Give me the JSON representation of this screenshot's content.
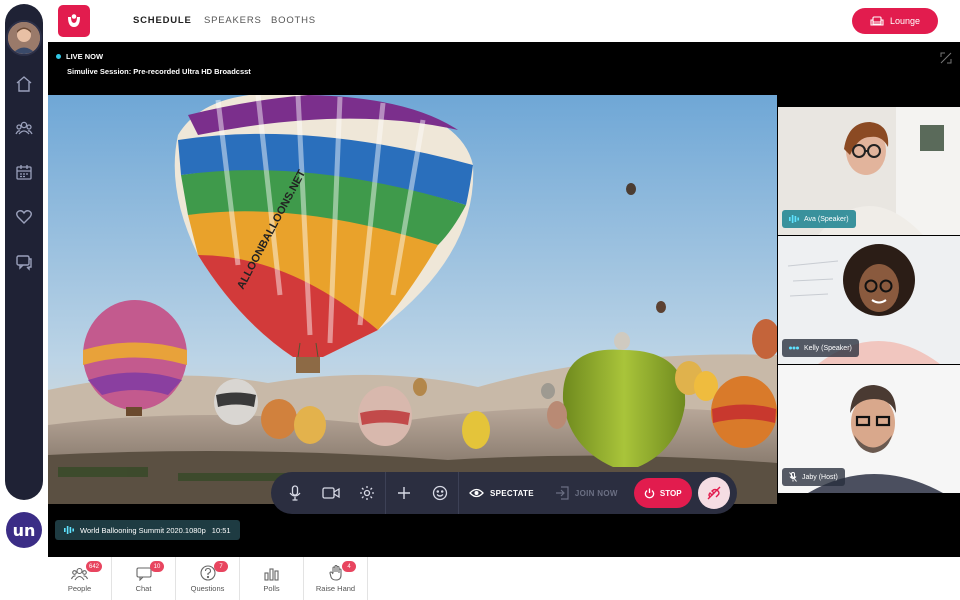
{
  "header": {
    "nav": [
      "SCHEDULE",
      "SPEAKERS",
      "BOOTHS"
    ],
    "lounge_label": "Lounge"
  },
  "stage": {
    "live_label": "LIVE NOW",
    "session_title": "Simulive Session: Pre-recorded Ultra HD Broadcsst",
    "stream_file": "World Ballooning Summit 2020.1080p",
    "stream_time": "10:51"
  },
  "speakers": [
    {
      "name": "Ava (Speaker)",
      "active": true
    },
    {
      "name": "Kelly (Speaker)",
      "active": false
    },
    {
      "name": "Jaby (Host)",
      "active": false
    }
  ],
  "controls": {
    "spectate_label": "SPECTATE",
    "join_label": "JOIN NOW",
    "stop_label": "STOP"
  },
  "tabs": [
    {
      "label": "People",
      "count": "642",
      "icon": "people-icon"
    },
    {
      "label": "Chat",
      "count": "10",
      "icon": "chat-icon"
    },
    {
      "label": "Questions",
      "count": "7",
      "icon": "question-icon"
    },
    {
      "label": "Polls",
      "count": "",
      "icon": "polls-icon"
    },
    {
      "label": "Raise Hand",
      "count": "4",
      "icon": "raise-hand-icon"
    }
  ],
  "brand": {
    "badge_text": "un",
    "accent": "#e21c4e",
    "live_dot": "#32c8e6"
  },
  "balloon_text": "ALLOONBALLOONS.NET"
}
